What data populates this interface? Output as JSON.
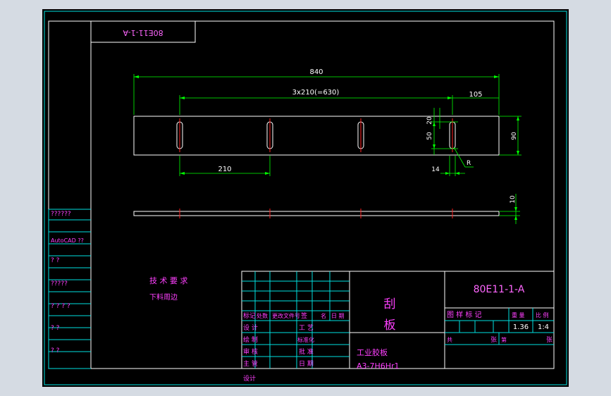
{
  "drawing": {
    "title_box_text": "80E11-1-A",
    "dimensions": {
      "overall_length": "840",
      "pitch_pattern": "3x210(=630)",
      "end_offset": "105",
      "pitch": "210",
      "slot_width": "14",
      "slot_length": "50",
      "slot_offset": "20",
      "plate_height": "90",
      "thickness": "10",
      "radius": "R"
    },
    "side_column_labels": [
      "??????",
      "AutoCAD ??",
      "?    ?",
      "?????",
      "?  ?  ?  ?",
      "?        ?",
      "?        ?"
    ],
    "tech_notes": {
      "title": "技 术 要 求",
      "line1": "下料周边"
    },
    "title_block": {
      "drawing_number": "80E11-1-A",
      "part_name_1": "刮",
      "part_name_2": "板",
      "material": "工业胶板",
      "material_spec": "A3-7H6Hr1",
      "header_labels": [
        "标记",
        "处数",
        "更改文件号",
        "签",
        "名",
        "日 期"
      ],
      "row_labels_left": [
        "设 计",
        "绘 制",
        "审 核",
        "主 管",
        "设计"
      ],
      "row_labels_mid": [
        "工 艺",
        "标准化",
        "批 准",
        "日 期"
      ],
      "stage_label": "图 样 标 记",
      "weight_label": "重 量",
      "scale_label": "比 例",
      "weight_value": "1.36",
      "scale_value": "1:4",
      "sheet_label": "共",
      "sheet_label2": "张",
      "sheet_label3": "第",
      "sheet_label4": "张"
    }
  },
  "colors": {
    "background": "#000000",
    "frame": "#ffffff",
    "table_lines": "#00e0e0",
    "dimension": "#00ff00",
    "centerline": "#ff2020",
    "text": "#ff40ff",
    "title_text": "#ff66ff"
  }
}
